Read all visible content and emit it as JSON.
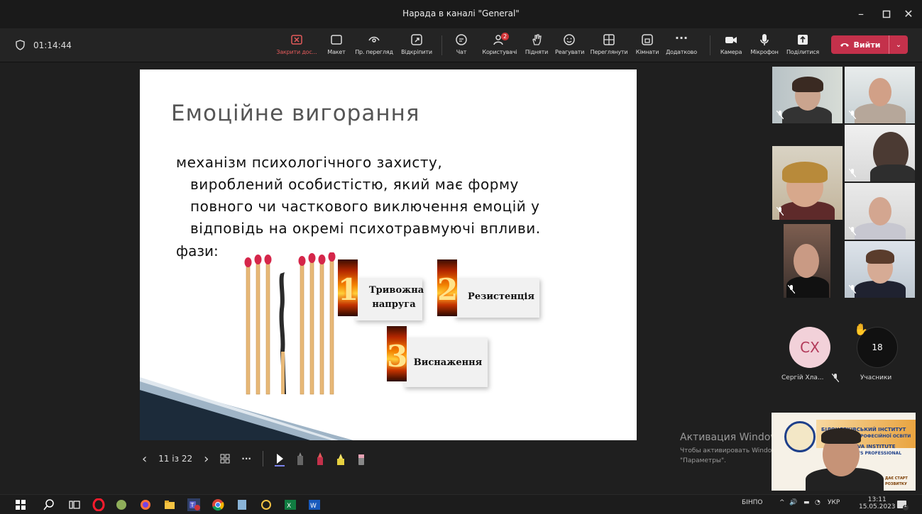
{
  "window": {
    "title": "Нарада в каналі \"General\""
  },
  "meeting": {
    "timer": "01:14:44",
    "toolbar": [
      {
        "label": "Закрити дос...",
        "icon": "stop-share-icon"
      },
      {
        "label": "Макет",
        "icon": "layout-icon"
      },
      {
        "label": "Пр. перегляд",
        "icon": "view-icon"
      },
      {
        "label": "Відкріпити",
        "icon": "popout-icon"
      },
      {
        "label": "Чат",
        "icon": "chat-icon"
      },
      {
        "label": "Користувачі",
        "icon": "people-icon",
        "badge": "2"
      },
      {
        "label": "Підняти",
        "icon": "raise-hand-icon"
      },
      {
        "label": "Реагувати",
        "icon": "react-icon"
      },
      {
        "label": "Переглянути",
        "icon": "grid-icon"
      },
      {
        "label": "Кімнати",
        "icon": "rooms-icon"
      },
      {
        "label": "Додатково",
        "icon": "more-icon"
      },
      {
        "label": "Камера",
        "icon": "camera-icon"
      },
      {
        "label": "Мікрофон",
        "icon": "mic-icon"
      },
      {
        "label": "Поділитися",
        "icon": "share-icon"
      }
    ],
    "leave_label": "Вийти"
  },
  "slide": {
    "title": "Емоційне вигорання",
    "body_lines": [
      "механізм психологічного захисту,",
      "вироблений особистістю, який має форму",
      "повного чи часткового виключення емоцій у",
      "відповідь на окремі психотравмуючі впливи."
    ],
    "phases_label": "фази:",
    "phases": [
      {
        "number": "1",
        "label_line1": "Тривожна",
        "label_line2": "напруга"
      },
      {
        "number": "2",
        "label_line1": "Резистенція",
        "label_line2": ""
      },
      {
        "number": "3",
        "label_line1": "Виснаження",
        "label_line2": ""
      }
    ]
  },
  "slide_controls": {
    "page": "11 із 22"
  },
  "participants": {
    "avatar_initials": "СХ",
    "avatar_name": "Сергій Хла...",
    "count": "18",
    "count_label": "Учасники"
  },
  "activation": {
    "line1": "Активация Windows",
    "line2": "Чтобы активировать Windows, перейдите в раздел",
    "line3": "\"Параметры\"."
  },
  "share_preview": {
    "line1": "БІЛОЦЕРКІВСЬКИЙ ІНСТИТУТ",
    "line2": "НЕПЕРЕРВНОЇ ПРОФЕСІЙНОЇ ОСВІТИ",
    "line3": "EVA INSTITUTE",
    "line4": "IN'S PROFESSIONAL",
    "line5": "ДАЄ СТАРТ",
    "line6": "РОЗВИТКУ"
  },
  "taskbar": {
    "lang_name": "БІНПО",
    "lang": "УКР",
    "time": "13:11",
    "date": "15.05.2023",
    "notif": "1"
  },
  "colors": {
    "leave": "#c4314b",
    "accent_red": "#e35b5b",
    "avatar_bg": "#f2d1d9"
  }
}
